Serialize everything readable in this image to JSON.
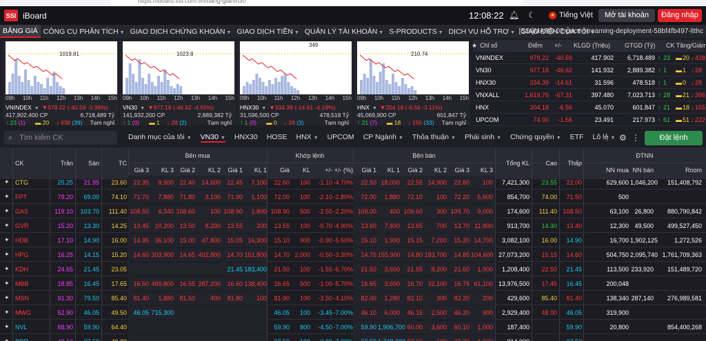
{
  "browser": {
    "url": "https://iboard.ssi.com.vn/bang-gia/vn30"
  },
  "header": {
    "logo": "SSI",
    "brand": "iBoard",
    "clock": "12:08:22",
    "language": "Tiếng Việt",
    "open_account": "Mở tài khoản",
    "login": "Đăng nhập"
  },
  "menu": {
    "items": [
      "BẢNG GIÁ",
      "CÔNG CỤ PHÂN TÍCH",
      "GIAO DỊCH CHỨNG KHOÁN",
      "GIAO DỊCH TIỀN",
      "QUẢN LÝ TÀI KHOẢN",
      "S-PRODUCTS",
      "DỊCH VỤ HỖ TRỢ",
      "GIAO DIỆN CỦA TÔI"
    ],
    "has_caret": [
      false,
      true,
      true,
      true,
      true,
      true,
      true,
      true
    ],
    "deploy": "[SSI]MARS-02-price-streaming-deployment-58bf4fb497-ltthc"
  },
  "mini_charts": [
    {
      "name": "VNINDEX",
      "peak": "1019.81",
      "value": "979.22",
      "change": "-40.59",
      "pct": "-3.98%",
      "volume": "417,902,400 CP",
      "money": "6,718,489 Tỷ",
      "up": "23",
      "up_ceil": "1",
      "ref": "20",
      "down": "438",
      "down_floor": "39",
      "status": "Tạm nghỉ"
    },
    {
      "name": "VN30",
      "peak": "1023.8",
      "value": "977.18",
      "change": "-46.62",
      "pct": "-4.55%",
      "volume": "141,932,200 CP",
      "money": "2,889,382 Tỷ",
      "up": "1",
      "up_ceil": "0",
      "ref": "1",
      "down": "28",
      "down_floor": "2",
      "status": "Tạm nghỉ"
    },
    {
      "name": "HNX30",
      "peak": "349",
      "value": "334.39",
      "change": "-14.61",
      "pct": "-4.19%",
      "volume": "31,596,500 CP",
      "money": "478,518 Tỷ",
      "up": "1",
      "up_ceil": "0",
      "ref": "0",
      "down": "28",
      "down_floor": "3",
      "status": "Tạm nghỉ"
    },
    {
      "name": "HNX",
      "peak": "210.74",
      "value": "204.18",
      "change": "-6.56",
      "pct": "-3.11%",
      "volume": "45,069,900 CP",
      "money": "601,847 Tỷ",
      "up": "21",
      "up_ceil": "7",
      "ref": "18",
      "down": "155",
      "down_floor": "33",
      "status": "Tạm nghỉ"
    }
  ],
  "chart_hours": [
    "09h",
    "10h",
    "11h",
    "12h",
    "13h",
    "14h",
    "15h"
  ],
  "index_table": {
    "headers": [
      "Chỉ số",
      "Điểm",
      "+/-",
      "KLGD (Triệu)",
      "GTGD (Tỷ)",
      "CK Tăng/Giảm"
    ],
    "rows": [
      {
        "name": "VNINDEX",
        "point": "979.22",
        "chg": "-40.59",
        "vol": "417.902",
        "val": "6,718.489",
        "up": "23",
        "ref": "20",
        "down": "438"
      },
      {
        "name": "VN30",
        "point": "977.18",
        "chg": "-46.62",
        "vol": "141.932",
        "val": "2,889.382",
        "up": "1",
        "ref": "1",
        "down": "28"
      },
      {
        "name": "HNX30",
        "point": "334.39",
        "chg": "-14.61",
        "vol": "31.596",
        "val": "478.518",
        "up": "1",
        "ref": "0",
        "down": "28"
      },
      {
        "name": "VNXALL",
        "point": "1,619.76",
        "chg": "-67.31",
        "vol": "397.480",
        "val": "7,023.713",
        "up": "28",
        "ref": "21",
        "down": "396"
      },
      {
        "name": "HNX",
        "point": "204.18",
        "chg": "-6.56",
        "vol": "45.070",
        "val": "601.847",
        "up": "21",
        "ref": "18",
        "down": "155"
      },
      {
        "name": "UPCOM",
        "point": "74.00",
        "chg": "-1.66",
        "vol": "23.491",
        "val": "217.973",
        "up": "61",
        "ref": "51",
        "down": "222"
      }
    ]
  },
  "toolbar": {
    "search_placeholder": "Tìm kiếm CK",
    "tabs": [
      "Danh mục của tôi",
      "VN30",
      "HNX30",
      "HOSE",
      "HNX",
      "UPCOM",
      "CP Ngành",
      "Thỏa thuận",
      "Phái sinh",
      "Chứng quyền",
      "ETF",
      "Lô lẻ"
    ],
    "tabs_caret": [
      true,
      true,
      false,
      false,
      true,
      false,
      true,
      true,
      true,
      true,
      false,
      true
    ],
    "order_button": "Đặt lệnh"
  },
  "table": {
    "group_headers": [
      "Bên mua",
      "Khớp lệnh",
      "Bên bán",
      "ĐTNN"
    ],
    "columns": [
      "CK",
      "Trần",
      "Sàn",
      "TC",
      "Giá 3",
      "KL 3",
      "Giá 2",
      "KL 2",
      "Giá 1",
      "KL 1",
      "Giá",
      "KL",
      "+/-",
      "+/- (%)",
      "Giá 1",
      "KL 1",
      "Giá 2",
      "KL 2",
      "Giá 3",
      "KL 3",
      "Tổng KL",
      "Cao",
      "Thấp",
      "NN mua",
      "NN bán",
      "Room"
    ],
    "rows": [
      {
        "ck": "CTG",
        "c": [
          "25.25",
          "21.95",
          "23.60",
          "22.35",
          "9,600",
          "22.40",
          "14,600",
          "22.45",
          "7,100",
          "22.60",
          "100",
          "-1.10",
          "-4.70%",
          "22.50",
          "18,000",
          "22.55",
          "14,900",
          "22.60",
          "100",
          "7,421,300",
          "23.55",
          "22.00",
          "629,600",
          "1,046,200",
          "151,408,792"
        ]
      },
      {
        "ck": "FPT",
        "c": [
          "79.20",
          "69.00",
          "74.10",
          "71.70",
          "7,880",
          "71.80",
          "3,100",
          "71.90",
          "1,100",
          "72.00",
          "100",
          "-2.10",
          "-2.80%",
          "72.00",
          "1,880",
          "72.10",
          "100",
          "72.20",
          "5,600",
          "854,700",
          "74.00",
          "71.50",
          "500",
          "",
          ""
        ]
      },
      {
        "ck": "GAS",
        "c": [
          "119.10",
          "103.70",
          "111.40",
          "108.50",
          "6,340",
          "108.60",
          "100",
          "108.90",
          "1,800",
          "108.90",
          "500",
          "-2.50",
          "-2.20%",
          "109.00",
          "400",
          "109.60",
          "300",
          "109.70",
          "9,000",
          "174,600",
          "111.40",
          "108.50",
          "63,100",
          "26,800",
          "880,790,842"
        ]
      },
      {
        "ck": "GVR",
        "c": [
          "15.20",
          "13.30",
          "14.25",
          "13.45",
          "10,200",
          "13.50",
          "8,200",
          "13.55",
          "200",
          "13.55",
          "100",
          "-0.70",
          "-4.90%",
          "13.60",
          "7,600",
          "13.65",
          "700",
          "13.70",
          "11,800",
          "913,700",
          "14.30",
          "13.40",
          "12,300",
          "49,500",
          "499,527,450"
        ]
      },
      {
        "ck": "HDB",
        "c": [
          "17.10",
          "14.90",
          "16.00",
          "14.95",
          "36,100",
          "15.00",
          "47,800",
          "15.05",
          "16,300",
          "15.10",
          "900",
          "-0.90",
          "-5.60%",
          "15.10",
          "1,900",
          "15.15",
          "7,200",
          "15.20",
          "14,700",
          "3,082,100",
          "16.00",
          "14.90",
          "16,700",
          "1,902,125",
          "1,272,526"
        ]
      },
      {
        "ck": "HPG",
        "c": [
          "16.25",
          "14.15",
          "15.20",
          "14.60",
          "303,900",
          "14.65",
          "402,800",
          "14.70",
          "151,800",
          "14.70",
          "2,000",
          "-0.50",
          "-3.30%",
          "14.75",
          "155,900",
          "14.80",
          "183,700",
          "14.85",
          "104,600",
          "27,073,200",
          "15.15",
          "14.60",
          "504,750",
          "2,095,740",
          "1,761,709,363"
        ]
      },
      {
        "ck": "KDH",
        "c": [
          "24.65",
          "21.45",
          "23.05",
          "",
          "",
          "",
          "",
          "21.45",
          "183,400",
          "21.50",
          "100",
          "-1.55",
          "-6.70%",
          "21.50",
          "3,600",
          "21.55",
          "8,200",
          "21.60",
          "1,900",
          "1,208,400",
          "22.50",
          "21.45",
          "113,500",
          "233,920",
          "151,489,720"
        ]
      },
      {
        "ck": "MBB",
        "c": [
          "18.85",
          "16.45",
          "17.65",
          "16.50",
          "489,800",
          "16.55",
          "287,200",
          "16.60",
          "138,400",
          "16.65",
          "500",
          "-1.00",
          "-5.70%",
          "16.65",
          "3,600",
          "16.70",
          "32,100",
          "16.75",
          "61,100",
          "13,976,500",
          "17.45",
          "16.45",
          "200,048",
          "",
          ""
        ]
      },
      {
        "ck": "MSN",
        "c": [
          "91.30",
          "79.50",
          "85.40",
          "81.40",
          "1,880",
          "81.50",
          "400",
          "81.80",
          "100",
          "81.90",
          "100",
          "-3.50",
          "-4.10%",
          "82.00",
          "1,280",
          "82.10",
          "300",
          "82.20",
          "200",
          "429,600",
          "85.40",
          "81.40",
          "138,340",
          "287,140",
          "276,989,581"
        ]
      },
      {
        "ck": "MWG",
        "c": [
          "52.90",
          "46.05",
          "49.50",
          "46.05",
          "715,300",
          "",
          "",
          "",
          "",
          "46.05",
          "100",
          "-3.45",
          "-7.00%",
          "46.10",
          "6,000",
          "46.15",
          "2,500",
          "46.20",
          "900",
          "2,929,400",
          "48.00",
          "46.05",
          "319,900",
          "",
          ""
        ]
      },
      {
        "ck": "NVL",
        "c": [
          "68.90",
          "59.90",
          "64.40",
          "",
          "",
          "",
          "",
          "",
          "",
          "59.90",
          "800",
          "-4.50",
          "-7.00%",
          "59.90",
          "1,906,700",
          "60.00",
          "3,600",
          "60.10",
          "1,000",
          "187,400",
          "",
          "59.90",
          "20,800",
          "",
          "854,400,268"
        ]
      },
      {
        "ck": "PDR",
        "c": [
          "43.10",
          "37.50",
          "40.30",
          "",
          "",
          "",
          "",
          "",
          "",
          "37.50",
          "100",
          "-2.80",
          "-7.00%",
          "37.50",
          "1,748,200",
          "37.60",
          "100",
          "37.70",
          "1,200",
          "214,000",
          "",
          "37.50",
          "",
          "",
          ""
        ]
      }
    ],
    "row_colors": [
      [
        "yellow",
        "cyan",
        "magenta",
        "yellow",
        "red",
        "red",
        "red",
        "red",
        "red",
        "red",
        "red",
        "red",
        "red",
        "red",
        "red",
        "red",
        "red",
        "red",
        "red",
        "red",
        "white",
        "green",
        "red",
        "white",
        "white",
        "white"
      ],
      [
        "red",
        "magenta",
        "cyan",
        "yellow",
        "red",
        "red",
        "red",
        "red",
        "red",
        "red",
        "red",
        "red",
        "red",
        "red",
        "red",
        "red",
        "red",
        "red",
        "red",
        "red",
        "white",
        "yellow",
        "red",
        "white",
        "white",
        "white"
      ],
      [
        "red",
        "magenta",
        "cyan",
        "yellow",
        "red",
        "red",
        "red",
        "red",
        "red",
        "red",
        "red",
        "red",
        "red",
        "red",
        "red",
        "red",
        "red",
        "red",
        "red",
        "red",
        "white",
        "yellow",
        "red",
        "white",
        "white",
        "white"
      ],
      [
        "red",
        "magenta",
        "cyan",
        "yellow",
        "red",
        "red",
        "red",
        "red",
        "red",
        "red",
        "red",
        "red",
        "red",
        "red",
        "red",
        "red",
        "red",
        "red",
        "red",
        "red",
        "white",
        "green",
        "red",
        "white",
        "white",
        "white"
      ],
      [
        "red",
        "magenta",
        "cyan",
        "yellow",
        "red",
        "red",
        "red",
        "red",
        "red",
        "red",
        "red",
        "red",
        "red",
        "red",
        "red",
        "red",
        "red",
        "red",
        "red",
        "red",
        "white",
        "yellow",
        "cyan",
        "white",
        "white",
        "white"
      ],
      [
        "red",
        "magenta",
        "cyan",
        "yellow",
        "red",
        "red",
        "red",
        "red",
        "red",
        "red",
        "red",
        "red",
        "red",
        "red",
        "red",
        "red",
        "red",
        "red",
        "red",
        "red",
        "white",
        "red",
        "red",
        "white",
        "white",
        "white"
      ],
      [
        "red",
        "magenta",
        "cyan",
        "yellow",
        "red",
        "red",
        "red",
        "red",
        "cyan",
        "cyan",
        "red",
        "red",
        "red",
        "red",
        "red",
        "red",
        "red",
        "red",
        "red",
        "red",
        "white",
        "red",
        "cyan",
        "white",
        "white",
        "white"
      ],
      [
        "red",
        "magenta",
        "cyan",
        "yellow",
        "red",
        "red",
        "red",
        "red",
        "red",
        "red",
        "red",
        "red",
        "red",
        "red",
        "red",
        "red",
        "red",
        "red",
        "red",
        "red",
        "white",
        "red",
        "cyan",
        "white",
        "white",
        "white"
      ],
      [
        "red",
        "magenta",
        "cyan",
        "yellow",
        "red",
        "red",
        "red",
        "red",
        "red",
        "red",
        "red",
        "red",
        "red",
        "red",
        "red",
        "red",
        "red",
        "red",
        "red",
        "red",
        "white",
        "yellow",
        "red",
        "white",
        "white",
        "white"
      ],
      [
        "red",
        "magenta",
        "cyan",
        "yellow",
        "cyan",
        "cyan",
        "red",
        "red",
        "red",
        "red",
        "cyan",
        "cyan",
        "cyan",
        "cyan",
        "red",
        "red",
        "red",
        "red",
        "red",
        "red",
        "white",
        "red",
        "cyan",
        "white",
        "white",
        "white"
      ],
      [
        "cyan",
        "magenta",
        "cyan",
        "yellow",
        "red",
        "red",
        "red",
        "red",
        "red",
        "red",
        "cyan",
        "cyan",
        "cyan",
        "cyan",
        "cyan",
        "cyan",
        "red",
        "red",
        "red",
        "red",
        "white",
        "red",
        "cyan",
        "white",
        "white",
        "white"
      ],
      [
        "cyan",
        "magenta",
        "cyan",
        "yellow",
        "red",
        "red",
        "red",
        "red",
        "red",
        "red",
        "cyan",
        "cyan",
        "cyan",
        "cyan",
        "cyan",
        "cyan",
        "red",
        "red",
        "red",
        "red",
        "white",
        "red",
        "cyan",
        "white",
        "white",
        "white"
      ]
    ]
  }
}
